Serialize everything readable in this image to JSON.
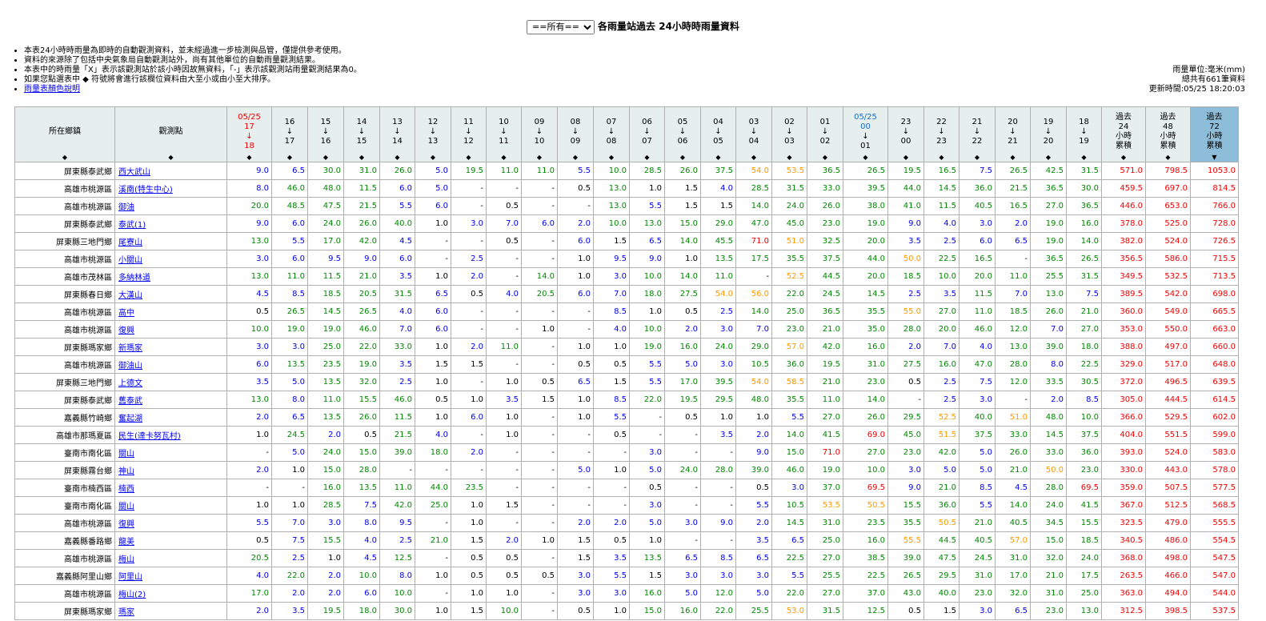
{
  "header": {
    "select_value": "==所有==",
    "title": "各雨量站過去 24小時時雨量資料"
  },
  "notes": [
    "本表24小時時雨量為即時的自動觀測資料，並未經過進一步檢測與品管，僅提供參考使用。",
    "資料的來源除了包括中央氣象局自動觀測站外，尚有其他單位的自動雨量觀測結果。",
    "本表中的時雨量「X」表示該觀測站於該小時因故無資料，「-」表示該觀測站雨量觀測結果為0。",
    "如果您點選表中 ◆ 符號將會進行該欄位資料由大至小或由小至大排序。"
  ],
  "color_link": "雨量表顏色說明",
  "meta": {
    "unit": "雨量單位:毫米(mm)",
    "total": "總共有661筆資料",
    "updated": "更新時間:05/25 18:20:03"
  },
  "colors": {
    "c1": "#0000ee",
    "c2": "#008800",
    "c3": "#000000",
    "c4": "#ff9900",
    "c5": "#ee0000",
    "header_bg": "#e6eeee",
    "selected_bg": "#8dbdd8"
  },
  "columns": {
    "town": "所在鄉鎮",
    "station": "觀測點",
    "hours": [
      [
        "05/25",
        "17",
        "↓",
        "18"
      ],
      [
        "16",
        "↓",
        "17"
      ],
      [
        "15",
        "↓",
        "16"
      ],
      [
        "14",
        "↓",
        "15"
      ],
      [
        "13",
        "↓",
        "14"
      ],
      [
        "12",
        "↓",
        "13"
      ],
      [
        "11",
        "↓",
        "12"
      ],
      [
        "10",
        "↓",
        "11"
      ],
      [
        "09",
        "↓",
        "10"
      ],
      [
        "08",
        "↓",
        "09"
      ],
      [
        "07",
        "↓",
        "08"
      ],
      [
        "06",
        "↓",
        "07"
      ],
      [
        "05",
        "↓",
        "06"
      ],
      [
        "04",
        "↓",
        "05"
      ],
      [
        "03",
        "↓",
        "04"
      ],
      [
        "02",
        "↓",
        "03"
      ],
      [
        "01",
        "↓",
        "02"
      ],
      [
        "05/25",
        "00",
        "↓",
        "01"
      ],
      [
        "23",
        "↓",
        "00"
      ],
      [
        "22",
        "↓",
        "23"
      ],
      [
        "21",
        "↓",
        "22"
      ],
      [
        "20",
        "↓",
        "21"
      ],
      [
        "19",
        "↓",
        "20"
      ],
      [
        "18",
        "↓",
        "19"
      ]
    ],
    "totals": [
      [
        "過去",
        "24",
        "小時",
        "累積"
      ],
      [
        "過去",
        "48",
        "小時",
        "累積"
      ],
      [
        "過去",
        "72",
        "小時",
        "累積"
      ]
    ]
  },
  "rows": [
    {
      "town": "屏東縣泰武鄉",
      "station": "西大武山",
      "values": [
        "9.0",
        "6.5",
        "30.0",
        "31.0",
        "26.0",
        "5.0",
        "19.5",
        "11.0",
        "11.0",
        "5.5",
        "10.0",
        "28.5",
        "26.0",
        "37.5",
        "54.0",
        "53.5",
        "36.5",
        "26.5",
        "19.5",
        "16.5",
        "7.5",
        "26.5",
        "42.5",
        "31.5",
        "571.0",
        "798.5",
        "1053.0"
      ]
    },
    {
      "town": "高雄市桃源區",
      "station": "溪南(特生中心)",
      "values": [
        "8.0",
        "46.0",
        "48.0",
        "11.5",
        "6.0",
        "5.0",
        "-",
        "-",
        "-",
        "0.5",
        "13.0",
        "1.0",
        "1.5",
        "4.0",
        "28.5",
        "31.5",
        "33.0",
        "39.5",
        "44.0",
        "14.5",
        "36.0",
        "21.5",
        "36.5",
        "30.0",
        "459.5",
        "697.0",
        "814.5"
      ]
    },
    {
      "town": "高雄市桃源區",
      "station": "御油",
      "values": [
        "20.0",
        "48.5",
        "47.5",
        "21.5",
        "5.5",
        "6.0",
        "-",
        "0.5",
        "-",
        "-",
        "13.0",
        "5.5",
        "1.5",
        "1.5",
        "14.0",
        "24.0",
        "26.0",
        "38.0",
        "41.0",
        "11.5",
        "40.5",
        "16.5",
        "27.0",
        "36.5",
        "446.0",
        "653.0",
        "766.0"
      ]
    },
    {
      "town": "屏東縣泰武鄉",
      "station": "泰武(1)",
      "values": [
        "9.0",
        "6.0",
        "24.0",
        "26.0",
        "40.0",
        "1.0",
        "3.0",
        "7.0",
        "6.0",
        "2.0",
        "10.0",
        "13.0",
        "15.0",
        "29.0",
        "47.0",
        "45.0",
        "23.0",
        "19.0",
        "9.0",
        "4.0",
        "3.0",
        "2.0",
        "19.0",
        "16.0",
        "378.0",
        "525.0",
        "728.0"
      ]
    },
    {
      "town": "屏東縣三地門鄉",
      "station": "尾寮山",
      "values": [
        "13.0",
        "5.5",
        "17.0",
        "42.0",
        "4.5",
        "-",
        "-",
        "0.5",
        "-",
        "6.0",
        "1.5",
        "6.5",
        "14.0",
        "45.5",
        "71.0",
        "51.0",
        "32.5",
        "20.0",
        "3.5",
        "2.5",
        "6.0",
        "6.5",
        "19.0",
        "14.0",
        "382.0",
        "524.0",
        "726.5"
      ]
    },
    {
      "town": "高雄市桃源區",
      "station": "小關山",
      "values": [
        "3.0",
        "6.0",
        "9.5",
        "9.0",
        "6.0",
        "-",
        "2.5",
        "-",
        "-",
        "1.0",
        "9.5",
        "9.0",
        "1.0",
        "13.5",
        "17.5",
        "35.5",
        "37.5",
        "44.0",
        "50.0",
        "22.5",
        "16.5",
        "-",
        "36.5",
        "26.5",
        "356.5",
        "586.0",
        "715.5"
      ]
    },
    {
      "town": "高雄市茂林區",
      "station": "多納林道",
      "values": [
        "13.0",
        "11.0",
        "11.5",
        "21.0",
        "3.5",
        "1.0",
        "2.0",
        "-",
        "14.0",
        "1.0",
        "3.0",
        "10.0",
        "14.0",
        "11.0",
        "-",
        "52.5",
        "44.5",
        "20.0",
        "18.5",
        "10.0",
        "20.0",
        "11.0",
        "25.5",
        "31.5",
        "349.5",
        "532.5",
        "713.5"
      ]
    },
    {
      "town": "屏東縣春日鄉",
      "station": "大漢山",
      "values": [
        "4.5",
        "8.5",
        "18.5",
        "20.5",
        "31.5",
        "6.5",
        "0.5",
        "4.0",
        "20.5",
        "6.0",
        "7.0",
        "18.0",
        "27.5",
        "54.0",
        "56.0",
        "22.0",
        "24.5",
        "14.5",
        "2.5",
        "3.5",
        "11.5",
        "7.0",
        "13.0",
        "7.5",
        "389.5",
        "542.0",
        "698.0"
      ]
    },
    {
      "town": "高雄市桃源區",
      "station": "高中",
      "values": [
        "0.5",
        "26.5",
        "14.5",
        "26.5",
        "4.0",
        "6.0",
        "-",
        "-",
        "-",
        "-",
        "8.5",
        "1.0",
        "0.5",
        "2.5",
        "14.0",
        "25.0",
        "36.5",
        "35.5",
        "55.0",
        "27.0",
        "11.0",
        "18.5",
        "26.0",
        "21.0",
        "360.0",
        "549.0",
        "665.5"
      ]
    },
    {
      "town": "高雄市桃源區",
      "station": "復興",
      "values": [
        "10.0",
        "19.0",
        "19.0",
        "46.0",
        "7.0",
        "6.0",
        "-",
        "-",
        "1.0",
        "-",
        "4.0",
        "10.0",
        "2.0",
        "3.0",
        "7.0",
        "23.0",
        "21.0",
        "35.0",
        "28.0",
        "20.0",
        "46.0",
        "12.0",
        "7.0",
        "27.0",
        "353.0",
        "550.0",
        "663.0"
      ]
    },
    {
      "town": "屏東縣瑪家鄉",
      "station": "新瑪家",
      "values": [
        "3.0",
        "3.0",
        "25.0",
        "22.0",
        "33.0",
        "1.0",
        "2.0",
        "11.0",
        "-",
        "1.0",
        "1.0",
        "19.0",
        "16.0",
        "24.0",
        "29.0",
        "57.0",
        "42.0",
        "16.0",
        "2.0",
        "7.0",
        "4.0",
        "13.0",
        "39.0",
        "18.0",
        "388.0",
        "497.0",
        "660.0"
      ]
    },
    {
      "town": "高雄市桃源區",
      "station": "御油山",
      "values": [
        "6.0",
        "13.5",
        "23.5",
        "19.0",
        "3.5",
        "1.5",
        "1.5",
        "-",
        "-",
        "0.5",
        "0.5",
        "5.5",
        "5.0",
        "3.0",
        "10.5",
        "36.0",
        "19.5",
        "31.0",
        "27.5",
        "16.0",
        "47.0",
        "28.0",
        "8.0",
        "22.5",
        "329.0",
        "517.0",
        "648.0"
      ]
    },
    {
      "town": "屏東縣三地門鄉",
      "station": "上德文",
      "values": [
        "3.5",
        "5.0",
        "13.5",
        "32.0",
        "2.5",
        "1.0",
        "-",
        "1.0",
        "0.5",
        "6.5",
        "1.5",
        "5.5",
        "17.0",
        "39.5",
        "54.0",
        "58.5",
        "21.0",
        "23.0",
        "0.5",
        "2.5",
        "7.5",
        "12.0",
        "33.5",
        "30.5",
        "372.0",
        "496.5",
        "639.5"
      ]
    },
    {
      "town": "屏東縣泰武鄉",
      "station": "舊泰武",
      "values": [
        "13.0",
        "8.0",
        "11.0",
        "15.5",
        "46.0",
        "0.5",
        "1.0",
        "3.5",
        "1.5",
        "1.0",
        "8.5",
        "22.0",
        "19.5",
        "29.5",
        "48.0",
        "35.5",
        "11.0",
        "14.0",
        "-",
        "2.5",
        "3.0",
        "-",
        "2.0",
        "8.5",
        "305.0",
        "444.5",
        "614.5"
      ]
    },
    {
      "town": "嘉義縣竹崎鄉",
      "station": "奮起湖",
      "values": [
        "2.0",
        "6.5",
        "13.5",
        "26.0",
        "11.5",
        "1.0",
        "6.0",
        "1.0",
        "-",
        "1.0",
        "5.5",
        "-",
        "0.5",
        "1.0",
        "1.0",
        "5.5",
        "27.0",
        "26.0",
        "29.5",
        "52.5",
        "40.0",
        "51.0",
        "48.0",
        "10.0",
        "366.0",
        "529.5",
        "602.0"
      ]
    },
    {
      "town": "高雄市那瑪夏區",
      "station": "民生(達卡努瓦村)",
      "values": [
        "1.0",
        "24.5",
        "2.0",
        "0.5",
        "21.5",
        "4.0",
        "-",
        "1.0",
        "-",
        "-",
        "0.5",
        "-",
        "-",
        "3.5",
        "2.0",
        "14.0",
        "41.5",
        "69.0",
        "45.0",
        "51.5",
        "37.5",
        "33.0",
        "14.5",
        "37.5",
        "404.0",
        "551.5",
        "599.0"
      ]
    },
    {
      "town": "臺南市南化區",
      "station": "關山",
      "values": [
        "-",
        "5.0",
        "24.0",
        "15.0",
        "39.0",
        "18.0",
        "2.0",
        "-",
        "-",
        "-",
        "-",
        "3.0",
        "-",
        "-",
        "9.0",
        "15.0",
        "71.0",
        "27.0",
        "23.0",
        "42.0",
        "5.0",
        "26.0",
        "33.0",
        "36.0",
        "393.0",
        "524.0",
        "583.0"
      ]
    },
    {
      "town": "屏東縣霧台鄉",
      "station": "神山",
      "values": [
        "2.0",
        "1.0",
        "15.0",
        "28.0",
        "-",
        "-",
        "-",
        "-",
        "-",
        "5.0",
        "1.0",
        "5.0",
        "24.0",
        "28.0",
        "39.0",
        "46.0",
        "19.0",
        "10.0",
        "3.0",
        "5.0",
        "5.0",
        "21.0",
        "50.0",
        "23.0",
        "330.0",
        "443.0",
        "578.0"
      ]
    },
    {
      "town": "臺南市楠西區",
      "station": "楠西",
      "values": [
        "-",
        "-",
        "16.0",
        "13.5",
        "11.0",
        "44.0",
        "23.5",
        "-",
        "-",
        "-",
        "-",
        "0.5",
        "-",
        "-",
        "0.5",
        "3.0",
        "37.0",
        "69.5",
        "9.0",
        "21.0",
        "8.5",
        "4.5",
        "28.0",
        "69.5",
        "359.0",
        "507.5",
        "577.5"
      ]
    },
    {
      "town": "臺南市南化區",
      "station": "關山",
      "values": [
        "1.0",
        "1.0",
        "28.5",
        "7.5",
        "42.0",
        "25.0",
        "1.0",
        "1.5",
        "-",
        "-",
        "-",
        "3.0",
        "-",
        "-",
        "5.5",
        "10.5",
        "53.5",
        "50.5",
        "15.5",
        "36.0",
        "5.5",
        "14.0",
        "24.0",
        "41.5",
        "367.0",
        "512.5",
        "568.5"
      ]
    },
    {
      "town": "高雄市桃源區",
      "station": "復興",
      "values": [
        "5.5",
        "7.0",
        "3.0",
        "8.0",
        "9.5",
        "-",
        "1.0",
        "-",
        "-",
        "2.0",
        "2.0",
        "5.0",
        "3.0",
        "9.0",
        "2.0",
        "14.5",
        "31.0",
        "23.5",
        "35.5",
        "50.5",
        "21.0",
        "40.5",
        "34.5",
        "15.5",
        "323.5",
        "479.0",
        "555.5"
      ]
    },
    {
      "town": "嘉義縣番路鄉",
      "station": "龍美",
      "values": [
        "0.5",
        "7.5",
        "15.5",
        "4.0",
        "2.5",
        "21.0",
        "1.5",
        "2.0",
        "1.0",
        "1.5",
        "0.5",
        "1.0",
        "-",
        "-",
        "3.5",
        "6.5",
        "25.0",
        "16.0",
        "55.5",
        "44.5",
        "40.5",
        "57.0",
        "15.0",
        "18.5",
        "340.5",
        "486.0",
        "554.5"
      ]
    },
    {
      "town": "高雄市桃源區",
      "station": "梅山",
      "values": [
        "20.5",
        "2.5",
        "1.0",
        "4.5",
        "12.5",
        "-",
        "0.5",
        "0.5",
        "-",
        "1.5",
        "3.5",
        "13.5",
        "6.5",
        "8.5",
        "6.5",
        "22.5",
        "27.0",
        "38.5",
        "39.0",
        "47.5",
        "24.5",
        "31.0",
        "32.0",
        "24.0",
        "368.0",
        "498.0",
        "547.5"
      ]
    },
    {
      "town": "嘉義縣阿里山鄉",
      "station": "阿里山",
      "values": [
        "4.0",
        "22.0",
        "2.0",
        "10.0",
        "8.0",
        "1.0",
        "0.5",
        "0.5",
        "0.5",
        "3.0",
        "5.5",
        "1.5",
        "3.0",
        "3.0",
        "3.0",
        "5.5",
        "25.5",
        "22.5",
        "26.5",
        "29.5",
        "31.0",
        "17.0",
        "21.0",
        "17.5",
        "263.5",
        "466.0",
        "547.0"
      ]
    },
    {
      "town": "高雄市桃源區",
      "station": "梅山(2)",
      "values": [
        "17.0",
        "2.0",
        "2.0",
        "6.0",
        "10.0",
        "-",
        "1.0",
        "1.0",
        "-",
        "3.0",
        "3.0",
        "16.0",
        "5.0",
        "12.0",
        "5.0",
        "22.0",
        "27.0",
        "37.0",
        "43.0",
        "40.0",
        "23.0",
        "32.0",
        "31.0",
        "25.0",
        "363.0",
        "494.0",
        "544.0"
      ]
    },
    {
      "town": "屏東縣瑪家鄉",
      "station": "瑪家",
      "values": [
        "2.0",
        "3.5",
        "19.5",
        "18.0",
        "30.0",
        "1.0",
        "1.5",
        "10.0",
        "-",
        "0.5",
        "1.0",
        "15.0",
        "16.0",
        "22.0",
        "25.5",
        "53.0",
        "31.5",
        "12.5",
        "0.5",
        "1.5",
        "3.0",
        "6.5",
        "23.0",
        "13.0",
        "312.5",
        "398.5",
        "537.5"
      ]
    }
  ]
}
